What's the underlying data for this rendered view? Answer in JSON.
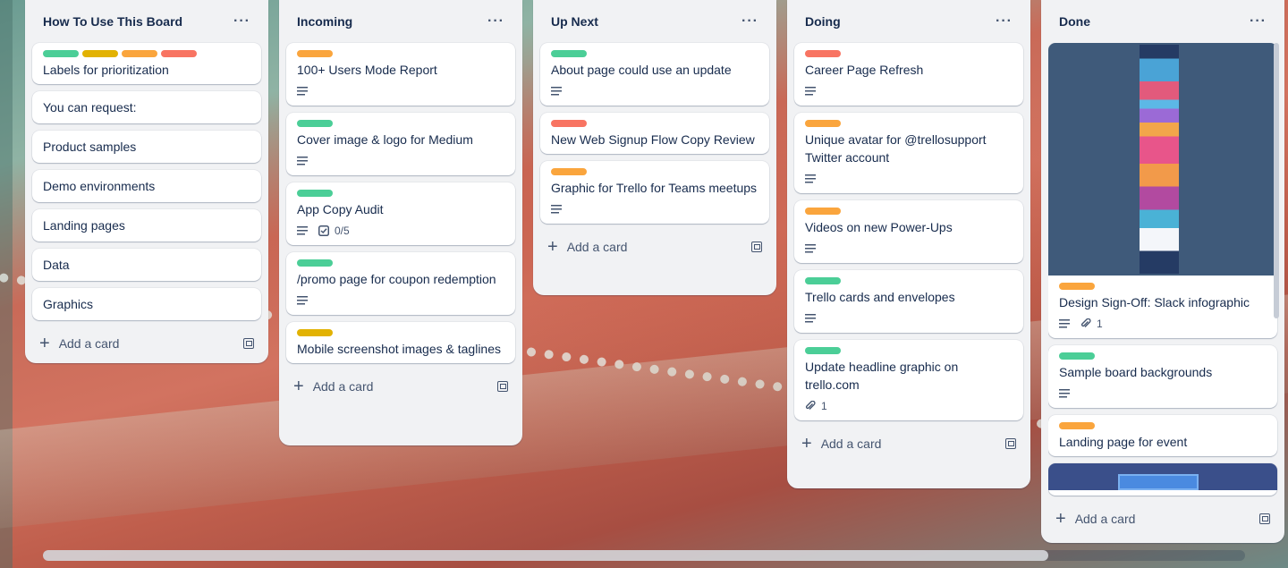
{
  "colors": {
    "green": "#4bce97",
    "yellow": "#e2b203",
    "orange": "#faa53d",
    "red": "#f87462",
    "list_bg": "#f1f2f4"
  },
  "lists": [
    {
      "title": "How To Use This Board",
      "cards": [
        {
          "title": "Labels for prioritization",
          "labels": [
            "green",
            "yellow",
            "orange",
            "red"
          ]
        },
        {
          "title": "You can request:"
        },
        {
          "title": "Product samples"
        },
        {
          "title": "Demo environments"
        },
        {
          "title": "Landing pages"
        },
        {
          "title": "Data"
        },
        {
          "title": "Graphics"
        }
      ],
      "add_label": "Add a card"
    },
    {
      "title": "Incoming",
      "cards": [
        {
          "title": "100+ Users Mode Report",
          "labels": [
            "orange"
          ],
          "description": true
        },
        {
          "title": "Cover image & logo for Medium",
          "labels": [
            "green"
          ],
          "description": true
        },
        {
          "title": "App Copy Audit",
          "labels": [
            "green"
          ],
          "description": true,
          "checklist": "0/5"
        },
        {
          "title": "/promo page for coupon redemption",
          "labels": [
            "green"
          ],
          "description": true
        },
        {
          "title": "Mobile screenshot images & taglines",
          "labels": [
            "yellow"
          ]
        }
      ],
      "add_label": "Add a card"
    },
    {
      "title": "Up Next",
      "cards": [
        {
          "title": "About page could use an update",
          "labels": [
            "green"
          ],
          "description": true
        },
        {
          "title": "New Web Signup Flow Copy Review",
          "labels": [
            "red"
          ]
        },
        {
          "title": "Graphic for Trello for Teams meetups",
          "labels": [
            "orange"
          ],
          "description": true
        }
      ],
      "add_label": "Add a card"
    },
    {
      "title": "Doing",
      "cards": [
        {
          "title": "Career Page Refresh",
          "labels": [
            "red"
          ],
          "description": true
        },
        {
          "title": "Unique avatar for @trellosupport Twitter account",
          "labels": [
            "orange"
          ],
          "description": true
        },
        {
          "title": "Videos on new Power-Ups",
          "labels": [
            "orange"
          ],
          "description": true
        },
        {
          "title": "Trello cards and envelopes",
          "labels": [
            "green"
          ],
          "description": true
        },
        {
          "title": "Update headline graphic on trello.com",
          "labels": [
            "green"
          ],
          "attachments": "1"
        }
      ],
      "add_label": "Add a card"
    },
    {
      "title": "Done",
      "cards": [
        {
          "title": "Design Sign-Off: Slack infographic",
          "labels": [
            "orange"
          ],
          "description": true,
          "attachments": "1",
          "cover": "infographic"
        },
        {
          "title": "Sample board backgrounds",
          "labels": [
            "green"
          ],
          "description": true
        },
        {
          "title": "Landing page for event",
          "labels": [
            "orange"
          ]
        }
      ],
      "add_label": "Add a card"
    }
  ],
  "icons": {
    "menu": "ellipsis-icon",
    "add": "plus-icon",
    "template": "card-template-icon",
    "description": "description-icon",
    "checklist": "checklist-icon",
    "attachment": "paperclip-icon"
  }
}
